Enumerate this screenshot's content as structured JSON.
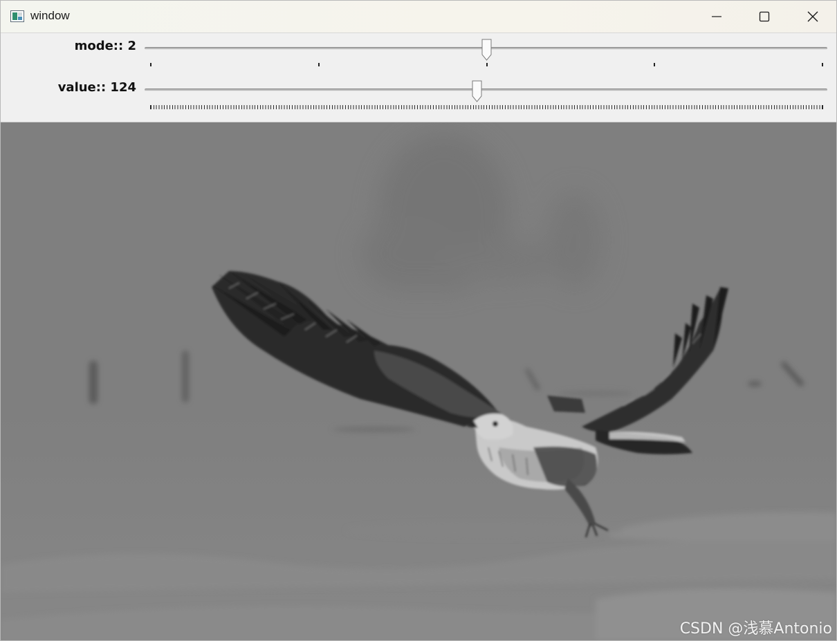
{
  "window": {
    "title": "window",
    "icon": "app-window-icon"
  },
  "title_bar_buttons": {
    "minimize": "minimize-icon",
    "maximize": "maximize-icon",
    "close": "close-icon"
  },
  "trackbars": [
    {
      "label": "mode:: 2",
      "value": 2,
      "min": 0,
      "max": 4,
      "tick_count": 5
    },
    {
      "label": "value:: 124",
      "value": 124,
      "min": 0,
      "max": 255,
      "tick_count": 256
    }
  ],
  "image": {
    "subject": "grayscale hawk in flight over snow",
    "watermark": "CSDN @浅慕Antonio"
  }
}
